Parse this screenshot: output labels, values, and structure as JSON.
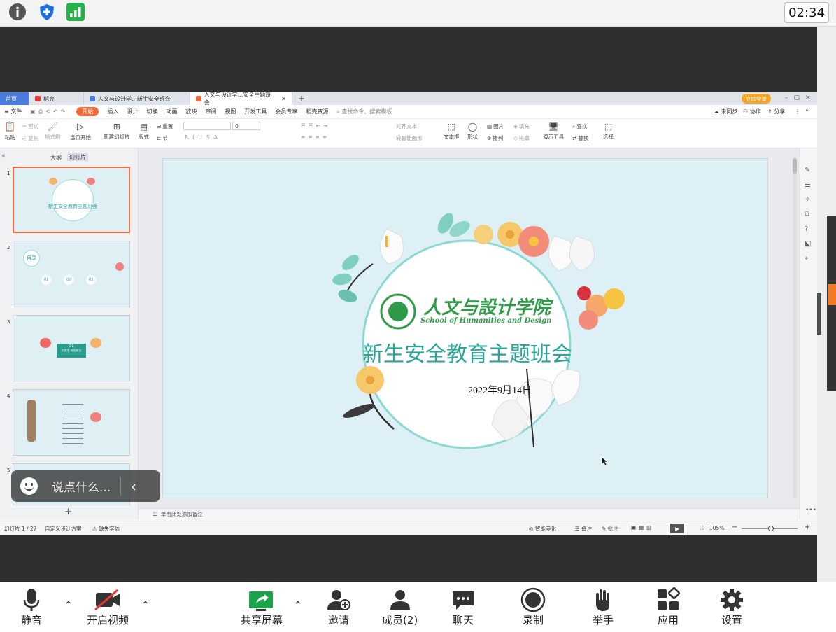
{
  "top": {
    "clock": "02:34"
  },
  "wps": {
    "tabs": [
      {
        "label": "首页"
      },
      {
        "label": "稻壳"
      },
      {
        "label": "人文与设计学...新生安全班会"
      },
      {
        "label": "人文与设计学...安全主题班会"
      }
    ],
    "login_label": "立即登录",
    "menu_file": "文件",
    "menus": [
      "开始",
      "插入",
      "设计",
      "切换",
      "动画",
      "放映",
      "审阅",
      "视图",
      "开发工具",
      "会员专享",
      "稻壳资源"
    ],
    "search_placeholder": "查找命令、搜索模板",
    "sync": "未同步",
    "collab": "协作",
    "share": "分享",
    "ribbon": {
      "paste": "粘贴",
      "cut": "剪切",
      "copy": "复制",
      "format_painter": "格式刷",
      "play_from_current": "当页开始",
      "new_slide": "新建幻灯片",
      "layout": "版式",
      "section": "节",
      "reset": "重置",
      "font_size": "0",
      "align_text": "对齐文本",
      "smartart": "转智能图形",
      "textbox": "文本框",
      "shape": "形状",
      "picture": "图片",
      "arrange": "排列",
      "fill": "填充",
      "outline": "轮廓",
      "presentation_tools": "演示工具",
      "find": "查找",
      "replace": "替换",
      "select": "选择"
    },
    "panel_tabs": [
      "大纲",
      "幻灯片"
    ],
    "slide_numbers": [
      "1",
      "2",
      "3",
      "4",
      "5"
    ],
    "thumbs": {
      "t1_title": "新生安全教育主题班会",
      "t2_title": "目录",
      "t2_items": [
        "01",
        "02",
        "03"
      ],
      "t3_num": "01",
      "t3_text": "大学生 校园安全"
    },
    "slide": {
      "logo_cn": "人文与設计学院",
      "logo_en": "School of Humanities and Design",
      "title": "新生安全教育主题班会",
      "date": "2022年9月14日"
    },
    "notes_placeholder": "单击此处添加备注",
    "status": {
      "slide_count": "幻灯片 1 / 27",
      "design": "自定义设计方案",
      "missing_font": "缺失字体",
      "beautify": "智能美化",
      "notes": "备注",
      "comments": "批注",
      "zoom": "105%"
    }
  },
  "chat": {
    "placeholder": "说点什么..."
  },
  "bottom": {
    "mute": "静音",
    "video": "开启视频",
    "share_screen": "共享屏幕",
    "invite": "邀请",
    "members": "成员(2)",
    "chat": "聊天",
    "record": "录制",
    "raise_hand": "举手",
    "apps": "应用",
    "settings": "设置"
  },
  "colors": {
    "accent": "#f06a3a",
    "slide_bg": "#dcf0f6",
    "title_teal": "#2aa59a",
    "share_green": "#1aa34a"
  }
}
